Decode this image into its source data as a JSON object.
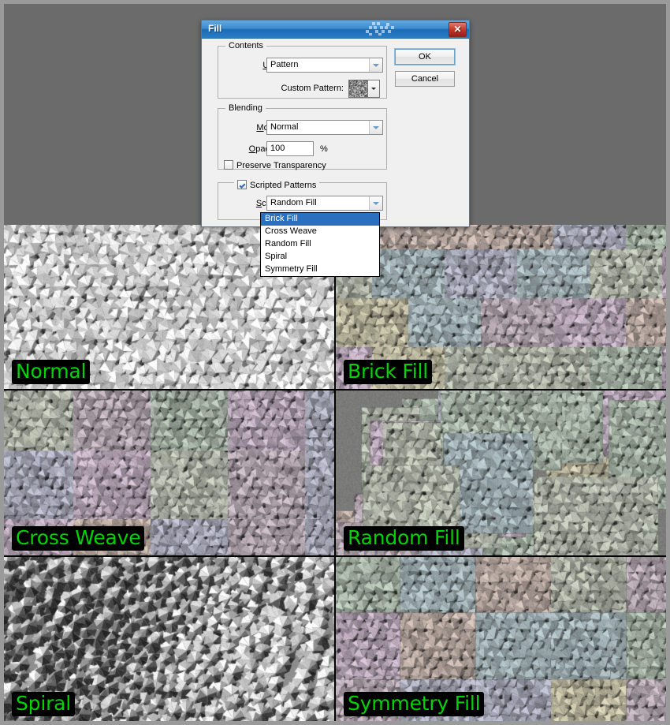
{
  "dialog": {
    "title": "Fill",
    "close_label": "✕",
    "buttons": {
      "ok": "OK",
      "cancel": "Cancel"
    },
    "contents": {
      "group_title": "Contents",
      "use_label": "Use:",
      "use_value": "Pattern",
      "custom_pattern_label": "Custom Pattern:"
    },
    "blending": {
      "group_title": "Blending",
      "mode_label": "Mode:",
      "mode_value": "Normal",
      "opacity_label": "Opacity:",
      "opacity_value": "100",
      "percent_symbol": "%",
      "preserve_transparency_label": "Preserve Transparency",
      "preserve_transparency_checked": false
    },
    "scripted": {
      "checkbox_label": "Scripted Patterns",
      "checkbox_checked": true,
      "script_label": "Script:",
      "script_value": "Random Fill",
      "options": [
        {
          "label": "Brick Fill",
          "selected": true
        },
        {
          "label": "Cross Weave",
          "selected": false
        },
        {
          "label": "Random Fill",
          "selected": false
        },
        {
          "label": "Spiral",
          "selected": false
        },
        {
          "label": "Symmetry Fill",
          "selected": false
        }
      ]
    }
  },
  "preview_grid": {
    "label_color": "#00d400",
    "label_background": "#000000",
    "panels": [
      {
        "label": "Normal",
        "style": "normal",
        "colored": false
      },
      {
        "label": "Brick Fill",
        "style": "brick",
        "colored": true
      },
      {
        "label": "Cross Weave",
        "style": "weave",
        "colored": true
      },
      {
        "label": "Random Fill",
        "style": "random",
        "colored": true
      },
      {
        "label": "Spiral",
        "style": "spiral",
        "colored": false
      },
      {
        "label": "Symmetry Fill",
        "style": "symmetry",
        "colored": true
      }
    ]
  },
  "theme": {
    "canvas_background": "#6b6b6b",
    "frame_background": "#9a9a9a",
    "title_bar_accent": "#1b6cb8",
    "selection_blue": "#2a6fc0",
    "close_button_red": "#c0392b"
  }
}
